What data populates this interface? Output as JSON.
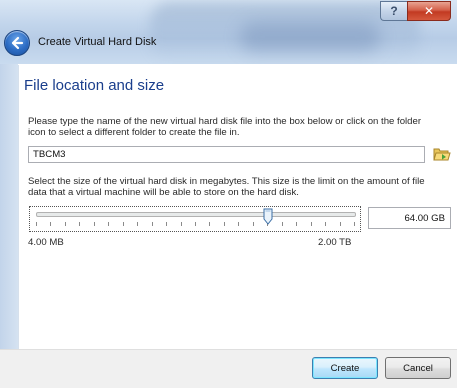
{
  "window": {
    "title": "Create Virtual Hard Disk",
    "help_glyph": "?",
    "close_glyph": "✕"
  },
  "page": {
    "heading": "File location and size",
    "location_instructions": "Please type the name of the new virtual hard disk file into the box below or click on the folder icon to select a different folder to create the file in.",
    "file_name": "TBCM3",
    "size_instructions": "Select the size of the virtual hard disk in megabytes. This size is the limit on the amount of file data that a virtual machine will be able to store on the hard disk.",
    "size_value": "64.00 GB",
    "size_min_label": "4.00 MB",
    "size_max_label": "2.00 TB",
    "slider_fraction": 0.73
  },
  "buttons": {
    "create": "Create",
    "cancel": "Cancel"
  },
  "icons": {
    "back": "back-arrow-icon",
    "folder": "folder-open-icon"
  },
  "colors": {
    "heading": "#1a3e8c",
    "accent_button_border": "#3c7fb1",
    "close_red": "#c23a22"
  }
}
